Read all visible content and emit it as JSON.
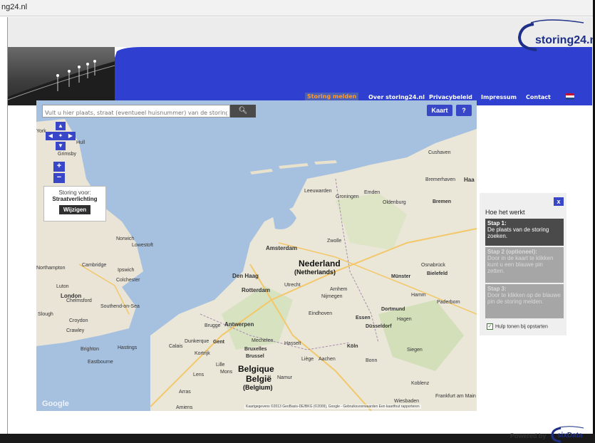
{
  "window": {
    "title": "ng24.nl"
  },
  "header": {
    "logo_text": "storing24.nl",
    "nav": [
      {
        "label": "Storing melden",
        "active": true
      },
      {
        "label": "Over storing24.nl",
        "active": false
      },
      {
        "label": "Privacybeleid",
        "active": false
      },
      {
        "label": "Impressum",
        "active": false
      },
      {
        "label": "Contact",
        "active": false
      }
    ],
    "flag_colors": [
      "#c8102e",
      "#ffffff",
      "#21468b"
    ]
  },
  "map": {
    "search_placeholder": "Vult u hier plaats, straat (eventueel huisnummer) van de storing in",
    "search_icon": "magnifier-icon",
    "map_type_label": "Kaart",
    "help_label": "?",
    "storing": {
      "line1": "Storing voor:",
      "line2": "Straatverlichting",
      "button": "Wijzigen"
    },
    "countries": {
      "nl": "Nederland",
      "nl_sub": "(Netherlands)",
      "be": "Belgique",
      "be_mid": "België",
      "be_sub": "(Belgium)"
    },
    "cities": [
      "Amsterdam",
      "Den Haag",
      "Rotterdam",
      "Utrecht",
      "Eindhoven",
      "Antwerpen",
      "Gent",
      "Bruxelles",
      "Brussel",
      "Liège",
      "Aachen",
      "Köln",
      "Düsseldorf",
      "Dortmund",
      "Essen",
      "Münster",
      "Bielefeld",
      "Osnabrück",
      "Bremen",
      "Oldenburg",
      "Groningen",
      "Leeuwarden",
      "Zwolle",
      "Arnhem",
      "Nijmegen",
      "Bonn",
      "Norwich",
      "Ipswich",
      "Cambridge",
      "Colchester",
      "London",
      "Brighton",
      "Eastbourne",
      "Dunkerque",
      "Calais",
      "Lille",
      "Brugge",
      "Mons",
      "Namur",
      "Koblenz",
      "Wiesbaden",
      "Frankfurt am Main",
      "Siegen",
      "Hagen",
      "Paderborn",
      "Emden",
      "Hamm",
      "Lens",
      "Arras",
      "Amiens",
      "Crawley",
      "Southend-on-Sea",
      "Chelmsford",
      "Luton",
      "Northampton",
      "Slough",
      "Croydon",
      "York",
      "Hull",
      "Grimsby",
      "Lowestoft",
      "Cushaven",
      "Hastings",
      "Kortrijk",
      "Mechelen",
      "Hasselt",
      "Bremerhaven",
      "Haa"
    ],
    "attribution": "Kaartgegevens ©2013 GeoBasis-DE/BKG (©2009), Google - Gebruiksvoorwaarden  Een kaartfout rapporteren",
    "google_logo": "Google"
  },
  "panel": {
    "close_label": "x",
    "title": "Hoe het werkt",
    "steps": [
      {
        "heading": "Stap 1:",
        "text": "De plaats van de storing zoeken.",
        "active": true
      },
      {
        "heading": "Stap 2 (optioneel):",
        "text": "Door in de kaart te klikken kunt u een blauwe pin zetten.",
        "active": false
      },
      {
        "heading": "Stap 3:",
        "text": "Door te klikken op de blauwe pin de storing melden.",
        "active": false
      }
    ],
    "checkbox_label": "Hulp tonen bij opstarten",
    "checkbox_checked": true
  },
  "footer": {
    "powered_by": "Powered by",
    "brand": "sixData"
  }
}
